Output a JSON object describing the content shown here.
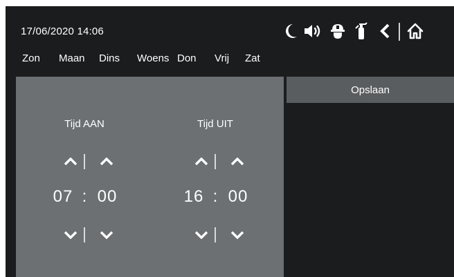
{
  "status": {
    "datetime": "17/06/2020  14:06"
  },
  "days": [
    "Zon",
    "Maan",
    "Dins",
    "Woens",
    "Don",
    "Vrij",
    "Zat"
  ],
  "header_icons": [
    "moon-icon",
    "speaker-icon",
    "firefighter-helmet-icon",
    "fire-extinguisher-icon",
    "back-arrow-icon",
    "home-icon"
  ],
  "timer": {
    "on": {
      "title": "Tijd AAN",
      "hours": "07",
      "minutes": "00",
      "separator": ":"
    },
    "off": {
      "title": "Tijd UIT",
      "hours": "16",
      "minutes": "00",
      "separator": ":"
    }
  },
  "actions": {
    "save_label": "Opslaan"
  },
  "colors": {
    "screen_bg": "#1b1c1d",
    "panel_bg": "#6c7073",
    "button_bg": "#5a5d60",
    "text": "#ffffff"
  }
}
